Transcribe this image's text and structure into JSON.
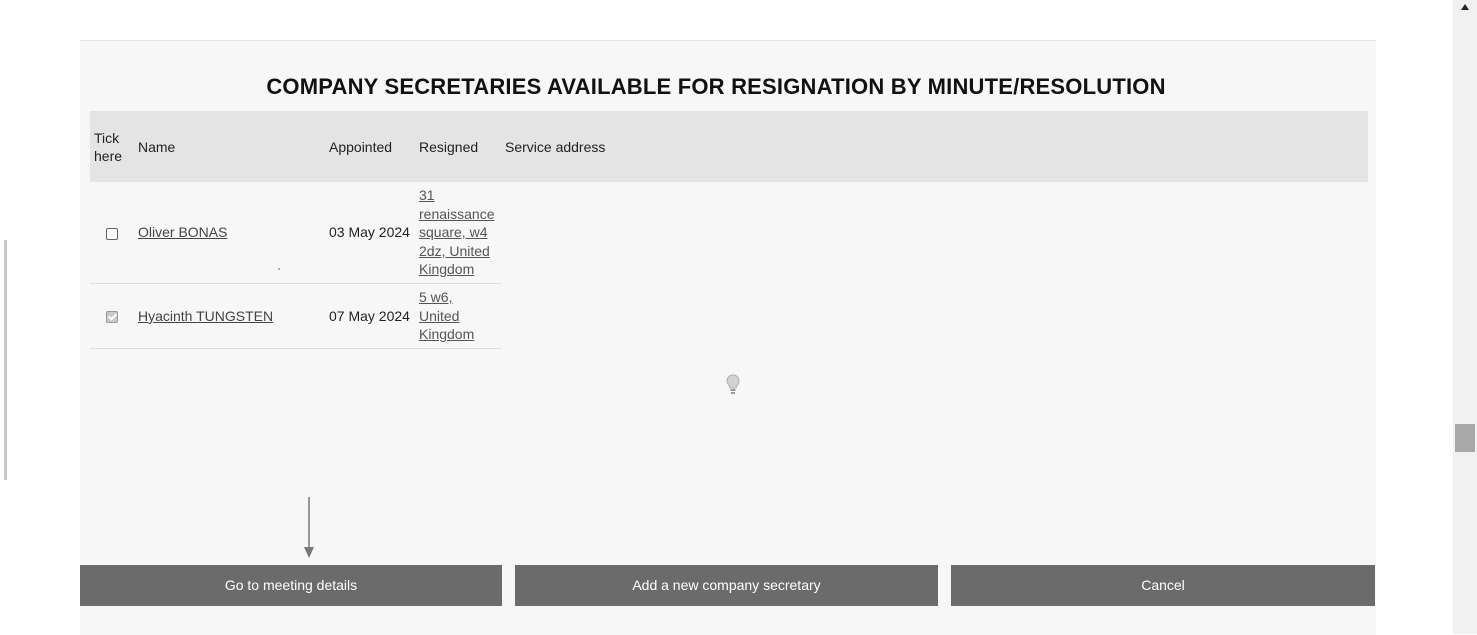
{
  "title": "COMPANY SECRETARIES AVAILABLE FOR RESIGNATION BY MINUTE/RESOLUTION",
  "table": {
    "headers": {
      "tick_line1": "Tick",
      "tick_line2": "here",
      "name": "Name",
      "appointed": "Appointed",
      "resigned": "Resigned",
      "service_address": "Service address"
    },
    "rows": [
      {
        "checked": false,
        "name": "Oliver BONAS",
        "appointed": "03 May 2024",
        "address_lines": [
          "31",
          "renaissance",
          "square, w4",
          "2dz, United",
          "Kingdom"
        ]
      },
      {
        "checked": true,
        "name": "Hyacinth TUNGSTEN",
        "appointed": "07 May 2024",
        "address_lines": [
          "5 w6,",
          "United",
          "Kingdom"
        ]
      }
    ]
  },
  "buttons": {
    "meeting": "Go to meeting details",
    "add": "Add a new company secretary",
    "cancel": "Cancel"
  },
  "icons": {
    "lightbulb": "lightbulb-icon",
    "arrow": "arrow-down-icon",
    "scroll_up": "scroll-up-arrow-icon"
  },
  "colors": {
    "button_bg": "#6b6b6b",
    "header_bg": "#e4e4e4",
    "panel_bg": "#f7f7f7"
  }
}
